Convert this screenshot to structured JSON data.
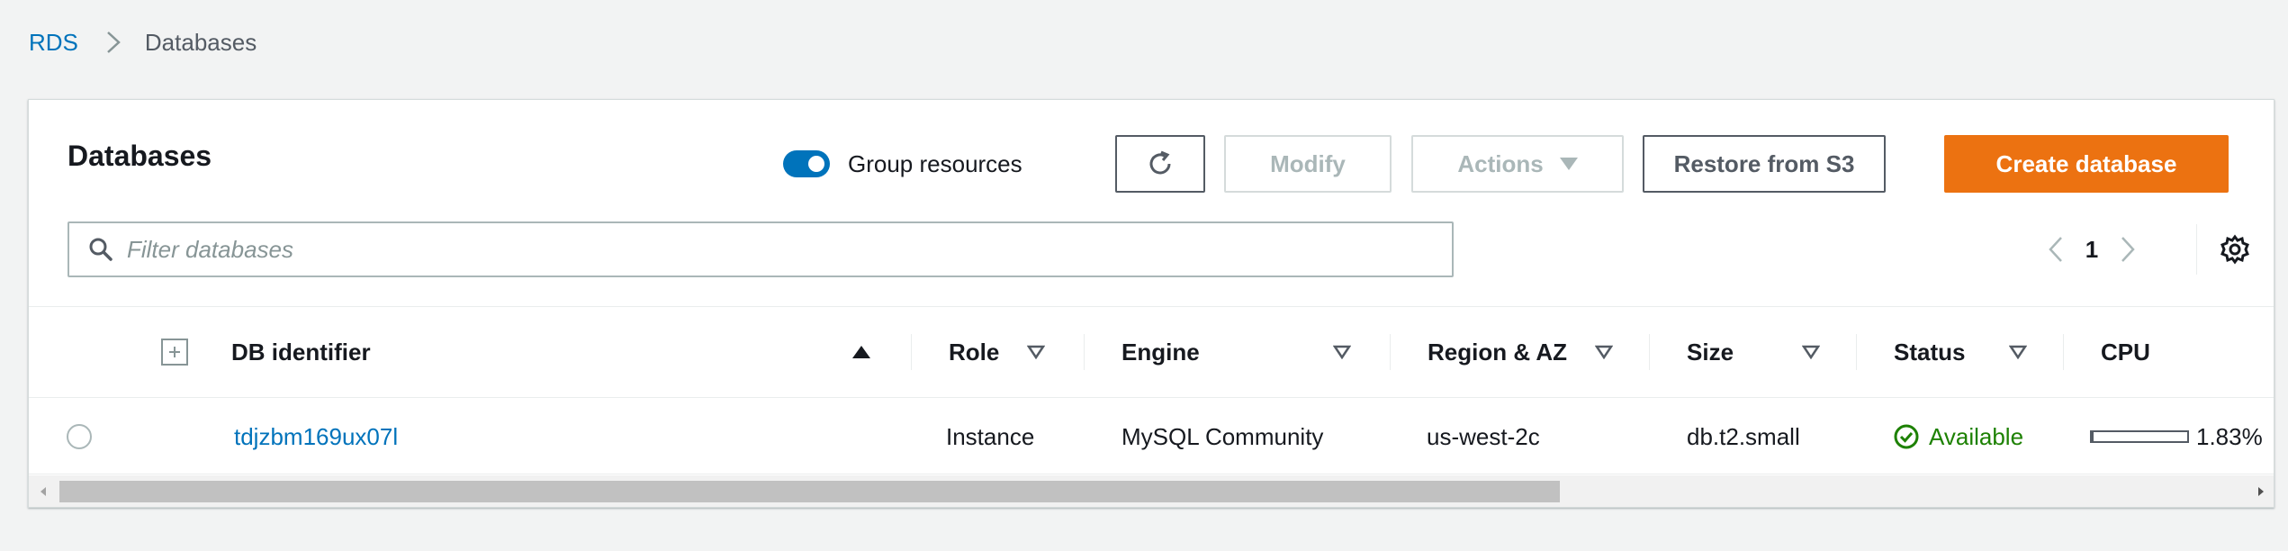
{
  "breadcrumb": {
    "root": "RDS",
    "current": "Databases"
  },
  "panel": {
    "title": "Databases"
  },
  "toggle": {
    "label": "Group resources",
    "on": true
  },
  "toolbar": {
    "modify_label": "Modify",
    "actions_label": "Actions",
    "restore_label": "Restore from S3",
    "create_label": "Create database"
  },
  "filter": {
    "placeholder": "Filter databases",
    "value": ""
  },
  "pagination": {
    "current_page": "1"
  },
  "table": {
    "columns": {
      "db_identifier": "DB identifier",
      "role": "Role",
      "engine": "Engine",
      "region": "Region & AZ",
      "size": "Size",
      "status": "Status",
      "cpu": "CPU"
    },
    "rows": [
      {
        "db_identifier": "tdjzbm169ux07l",
        "role": "Instance",
        "engine": "MySQL Community",
        "region": "us-west-2c",
        "size": "db.t2.small",
        "status": "Available",
        "cpu": "1.83%"
      }
    ]
  },
  "colors": {
    "accent": "#ec7211",
    "link": "#0073bb",
    "success": "#1d8102"
  },
  "icons": [
    "chevron-right-icon",
    "refresh-icon",
    "caret-down-icon",
    "search-icon",
    "chevron-left-icon",
    "gear-icon",
    "expand-all-icon",
    "sort-asc-icon",
    "sort-desc-icon",
    "check-circle-icon"
  ]
}
